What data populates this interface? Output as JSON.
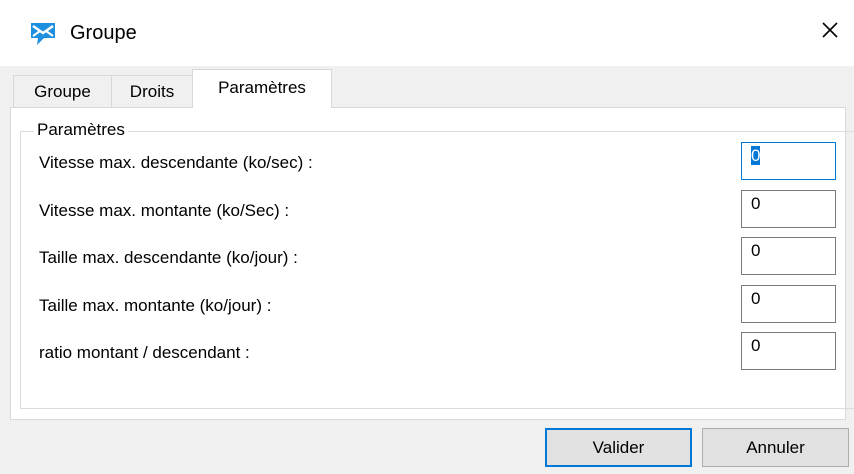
{
  "window": {
    "title": "Groupe",
    "icon": "group-envelope-icon",
    "close_icon": "close-icon"
  },
  "tabs": [
    {
      "label": "Groupe",
      "active": false
    },
    {
      "label": "Droits",
      "active": false
    },
    {
      "label": "Paramètres",
      "active": true
    }
  ],
  "group": {
    "legend": "Paramètres",
    "fields": [
      {
        "label": "Vitesse max. descendante (ko/sec) :",
        "value": "0",
        "focused": true
      },
      {
        "label": "Vitesse max. montante (ko/Sec) :",
        "value": "0"
      },
      {
        "label": "Taille max. descendante (ko/jour) :",
        "value": "0"
      },
      {
        "label": "Taille max. montante (ko/jour) :",
        "value": "0"
      },
      {
        "label": "ratio montant / descendant :",
        "value": "0"
      }
    ]
  },
  "buttons": {
    "ok_label": "Valider",
    "cancel_label": "Annuler"
  },
  "colors": {
    "accent": "#0078d7",
    "icon_blue": "#1e90e0",
    "window_bg": "#f0f0f0",
    "panel_bg": "#ffffff"
  }
}
